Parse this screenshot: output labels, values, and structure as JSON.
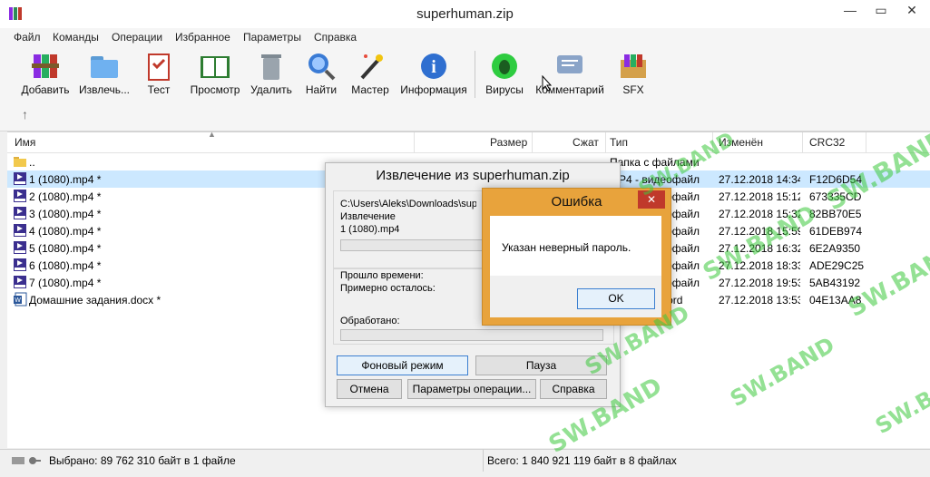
{
  "window": {
    "title": "superhuman.zip",
    "min": "—",
    "max": "▭",
    "close": "✕"
  },
  "menu": [
    "Файл",
    "Команды",
    "Операции",
    "Избранное",
    "Параметры",
    "Справка"
  ],
  "toolbar": [
    "Добавить",
    "Извлечь...",
    "Тест",
    "Просмотр",
    "Удалить",
    "Найти",
    "Мастер",
    "Информация",
    "Вирусы",
    "Комментарий",
    "SFX"
  ],
  "columns": {
    "name": "Имя",
    "size": "Размер",
    "packed": "Сжат",
    "type": "Тип",
    "modified": "Изменён",
    "crc": "CRC32"
  },
  "files": [
    {
      "name": "..",
      "type": "Папка с файлами",
      "modified": "",
      "crc": "",
      "icon": "folder"
    },
    {
      "name": "1 (1080).mp4 *",
      "type": "MP4 - видеофайл",
      "modified": "27.12.2018 14:34",
      "crc": "F12D6D54",
      "icon": "mp4"
    },
    {
      "name": "2 (1080).mp4 *",
      "type": "MP4 - видеофайл",
      "modified": "27.12.2018 15:12",
      "crc": "673335CD",
      "icon": "mp4"
    },
    {
      "name": "3 (1080).mp4 *",
      "type": "MP4 - видеофайл",
      "modified": "27.12.2018 15:32",
      "crc": "82BB70E5",
      "icon": "mp4"
    },
    {
      "name": "4 (1080).mp4 *",
      "type": "MP4 - видеофайл",
      "modified": "27.12.2018 15:59",
      "crc": "61DEB974",
      "icon": "mp4"
    },
    {
      "name": "5 (1080).mp4 *",
      "type": "MP4 - видеофайл",
      "modified": "27.12.2018 16:32",
      "crc": "6E2A9350",
      "icon": "mp4"
    },
    {
      "name": "6 (1080).mp4 *",
      "type": "MP4 - видеофайл",
      "modified": "27.12.2018 18:33",
      "crc": "ADE29C25",
      "icon": "mp4"
    },
    {
      "name": "7 (1080).mp4 *",
      "type": "MP4 - видеофайл",
      "modified": "27.12.2018 19:53",
      "crc": "5AB43192",
      "icon": "mp4"
    },
    {
      "name": "Домашние задания.docx *",
      "type": "Microsoft Word",
      "modified": "27.12.2018 13:53",
      "crc": "04E13AA8",
      "icon": "docx"
    }
  ],
  "status": {
    "selected": "Выбрано: 89 762 310 байт в 1 файле",
    "total": "Всего: 1 840 921 119 байт в 8 файлах"
  },
  "extract_dialog": {
    "title": "Извлечение из superhuman.zip",
    "path": "C:\\Users\\Aleks\\Downloads\\superhuman",
    "action": "Извлечение",
    "file": "1 (1080).mp4",
    "elapsed": "Прошло времени:",
    "remaining": "Примерно осталось:",
    "processed": "Обработано:",
    "btn_background": "Фоновый режим",
    "btn_pause": "Пауза",
    "btn_cancel": "Отмена",
    "btn_params": "Параметры операции...",
    "btn_help": "Справка"
  },
  "error_dialog": {
    "title": "Ошибка",
    "message": "Указан неверный пароль.",
    "ok": "OK",
    "close": "✕"
  },
  "watermark": "SW.BAND",
  "colors": {
    "accent": "#e8a33c",
    "selected_row": "#cce8ff",
    "watermark": "#3cc83c"
  }
}
